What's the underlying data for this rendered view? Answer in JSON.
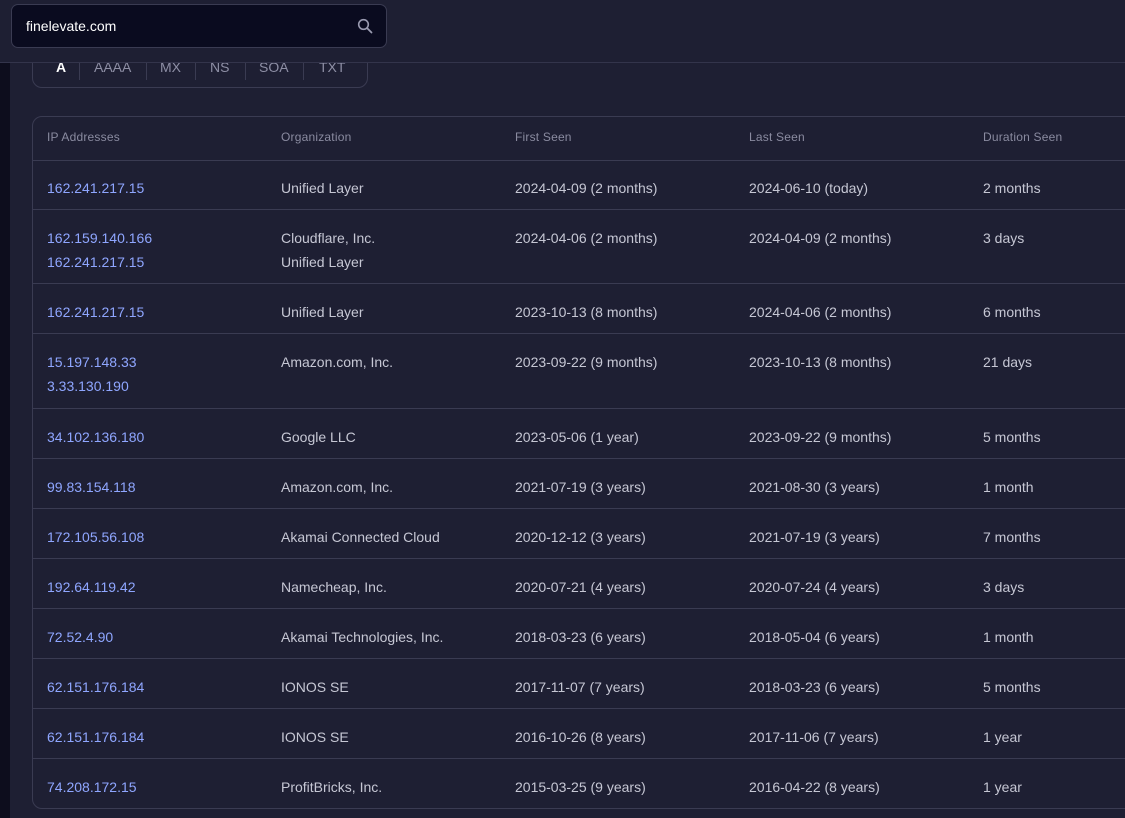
{
  "search": {
    "value": "finelevate.com",
    "icon": "search-icon"
  },
  "tabs": [
    "A",
    "AAAA",
    "MX",
    "NS",
    "SOA",
    "TXT"
  ],
  "table": {
    "headers": [
      "IP Addresses",
      "Organization",
      "First Seen",
      "Last Seen",
      "Duration Seen"
    ],
    "rows": [
      {
        "ips": [
          "162.241.217.15"
        ],
        "orgs": [
          "Unified Layer"
        ],
        "first_seen": "2024-04-09 (2 months)",
        "last_seen": "2024-06-10 (today)",
        "duration": "2 months"
      },
      {
        "ips": [
          "162.159.140.166",
          "162.241.217.15"
        ],
        "orgs": [
          "Cloudflare, Inc.",
          "Unified Layer"
        ],
        "first_seen": "2024-04-06 (2 months)",
        "last_seen": "2024-04-09 (2 months)",
        "duration": "3 days"
      },
      {
        "ips": [
          "162.241.217.15"
        ],
        "orgs": [
          "Unified Layer"
        ],
        "first_seen": "2023-10-13 (8 months)",
        "last_seen": "2024-04-06 (2 months)",
        "duration": "6 months"
      },
      {
        "ips": [
          "15.197.148.33",
          "3.33.130.190"
        ],
        "orgs": [
          "Amazon.com, Inc."
        ],
        "first_seen": "2023-09-22 (9 months)",
        "last_seen": "2023-10-13 (8 months)",
        "duration": "21 days"
      },
      {
        "ips": [
          "34.102.136.180"
        ],
        "orgs": [
          "Google LLC"
        ],
        "first_seen": "2023-05-06 (1 year)",
        "last_seen": "2023-09-22 (9 months)",
        "duration": "5 months"
      },
      {
        "ips": [
          "99.83.154.118"
        ],
        "orgs": [
          "Amazon.com, Inc."
        ],
        "first_seen": "2021-07-19 (3 years)",
        "last_seen": "2021-08-30 (3 years)",
        "duration": "1 month"
      },
      {
        "ips": [
          "172.105.56.108"
        ],
        "orgs": [
          "Akamai Connected Cloud"
        ],
        "first_seen": "2020-12-12 (3 years)",
        "last_seen": "2021-07-19 (3 years)",
        "duration": "7 months"
      },
      {
        "ips": [
          "192.64.119.42"
        ],
        "orgs": [
          "Namecheap, Inc."
        ],
        "first_seen": "2020-07-21 (4 years)",
        "last_seen": "2020-07-24 (4 years)",
        "duration": "3 days"
      },
      {
        "ips": [
          "72.52.4.90"
        ],
        "orgs": [
          "Akamai Technologies, Inc."
        ],
        "first_seen": "2018-03-23 (6 years)",
        "last_seen": "2018-05-04 (6 years)",
        "duration": "1 month"
      },
      {
        "ips": [
          "62.151.176.184"
        ],
        "orgs": [
          "IONOS SE"
        ],
        "first_seen": "2017-11-07 (7 years)",
        "last_seen": "2018-03-23 (6 years)",
        "duration": "5 months"
      },
      {
        "ips": [
          "62.151.176.184"
        ],
        "orgs": [
          "IONOS SE"
        ],
        "first_seen": "2016-10-26 (8 years)",
        "last_seen": "2017-11-06 (7 years)",
        "duration": "1 year"
      },
      {
        "ips": [
          "74.208.172.15"
        ],
        "orgs": [
          "ProfitBricks, Inc."
        ],
        "first_seen": "2015-03-25 (9 years)",
        "last_seen": "2016-04-22 (8 years)",
        "duration": "1 year"
      }
    ]
  },
  "colors": {
    "background": "#1e1f33",
    "link": "#8fa6ff",
    "text": "#c6c7d4",
    "muted": "#8a8ba0",
    "border": "#3a3b52"
  }
}
